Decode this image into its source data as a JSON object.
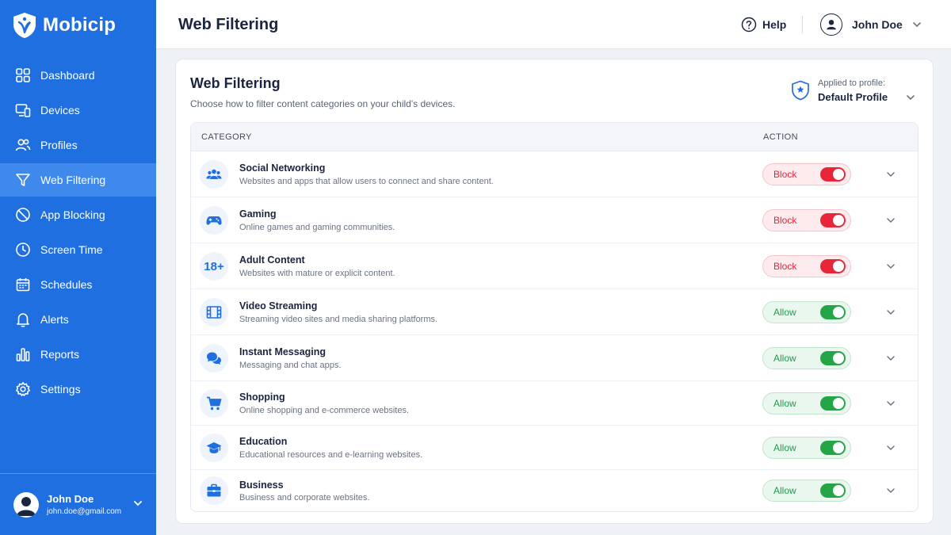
{
  "brand": {
    "name": "Mobicip"
  },
  "sidebar": {
    "items": [
      {
        "label": "Dashboard",
        "icon": "dashboard-icon"
      },
      {
        "label": "Devices",
        "icon": "devices-icon"
      },
      {
        "label": "Profiles",
        "icon": "profiles-icon"
      },
      {
        "label": "Web Filtering",
        "icon": "filter-icon",
        "active": true
      },
      {
        "label": "App Blocking",
        "icon": "block-icon"
      },
      {
        "label": "Screen Time",
        "icon": "clock-icon"
      },
      {
        "label": "Schedules",
        "icon": "calendar-icon"
      },
      {
        "label": "Alerts",
        "icon": "bell-icon"
      },
      {
        "label": "Reports",
        "icon": "bar-chart-icon"
      },
      {
        "label": "Settings",
        "icon": "gear-icon"
      }
    ],
    "user": {
      "name": "John Doe",
      "email": "john.doe@gmail.com"
    }
  },
  "header": {
    "title": "Web Filtering",
    "help_label": "Help",
    "user_name": "John Doe"
  },
  "card": {
    "title": "Web Filtering",
    "subtitle": "Choose how to filter content categories on your child's devices.",
    "profile_caption": "Applied to profile:",
    "profile_value": "Default Profile"
  },
  "table": {
    "col_category": "CATEGORY",
    "col_action": "ACTION",
    "rows": [
      {
        "name": "Social Networking",
        "desc": "Websites and apps that allow users to connect and share content.",
        "action": "Block",
        "icon": "people-icon"
      },
      {
        "name": "Gaming",
        "desc": "Online games and gaming communities.",
        "action": "Block",
        "icon": "gamepad-icon"
      },
      {
        "name": "Adult Content",
        "desc": "Websites with mature or explicit content.",
        "action": "Block",
        "icon": "age-18-icon",
        "icon_text": "18+"
      },
      {
        "name": "Video Streaming",
        "desc": "Streaming video sites and media sharing platforms.",
        "action": "Allow",
        "icon": "film-icon"
      },
      {
        "name": "Instant Messaging",
        "desc": "Messaging and chat apps.",
        "action": "Allow",
        "icon": "chat-icon"
      },
      {
        "name": "Shopping",
        "desc": "Online shopping and e-commerce websites.",
        "action": "Allow",
        "icon": "cart-icon"
      },
      {
        "name": "Education",
        "desc": "Educational resources and e-learning websites.",
        "action": "Allow",
        "icon": "graduation-cap-icon"
      },
      {
        "name": "Business",
        "desc": "Business and corporate websites.",
        "action": "Allow",
        "icon": "briefcase-icon"
      }
    ]
  },
  "colors": {
    "sidebar": "#1f6fe0",
    "active_item": "#4089ec",
    "block": "#e8263a",
    "allow": "#24a548"
  }
}
